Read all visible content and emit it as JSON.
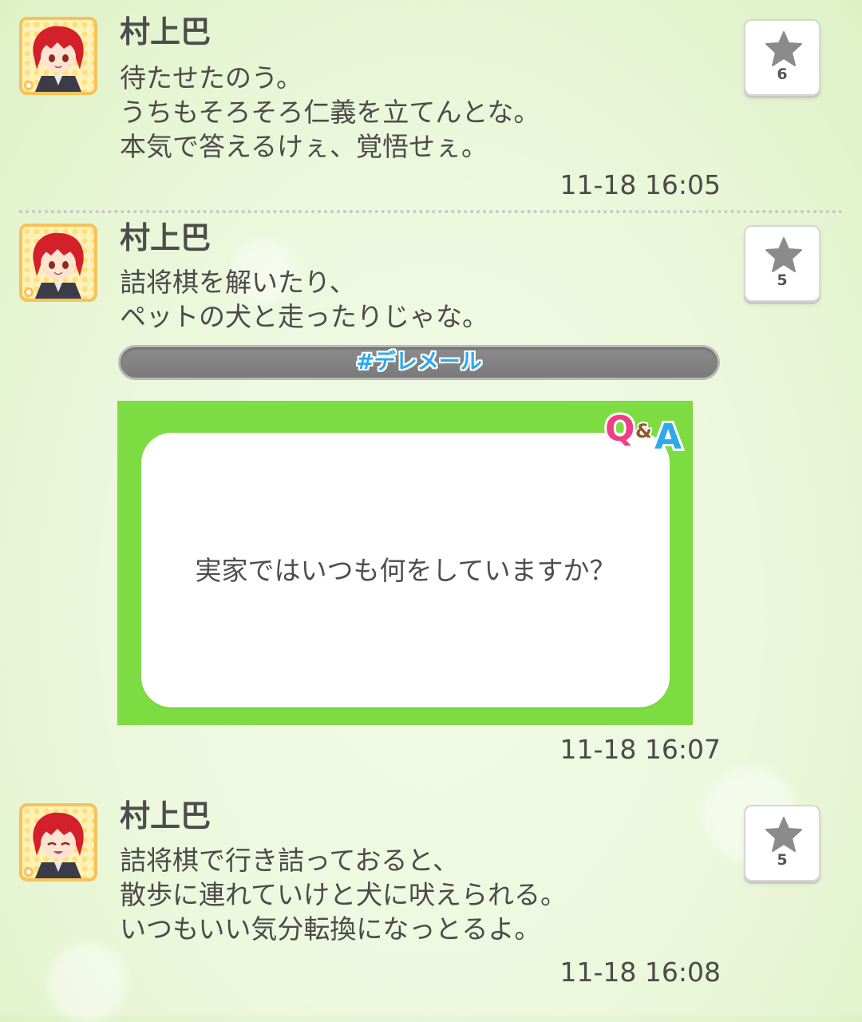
{
  "posts": [
    {
      "author": "村上巴",
      "lines": [
        "待たせたのう。",
        "うちもそろそろ仁義を立てんとな。",
        "本気で答えるけぇ、覚悟せぇ。"
      ],
      "likes": "6",
      "timestamp": "11-18 16:05"
    },
    {
      "author": "村上巴",
      "lines": [
        "詰将棋を解いたり、",
        "ペットの犬と走ったりじゃな。"
      ],
      "likes": "5",
      "hashtag": "#デレメール",
      "qa_logo": "Q&A",
      "question": "実家ではいつも何をしていますか？",
      "timestamp": "11-18 16:07"
    },
    {
      "author": "村上巴",
      "lines": [
        "詰将棋で行き詰っておると、",
        "散歩に連れていけと犬に吠えられる。",
        "いつもいい気分転換になっとるよ。"
      ],
      "likes": "5",
      "timestamp": "11-18 16:08"
    }
  ],
  "colors": {
    "accent_green": "#7ddc42",
    "hashtag_blue": "#2fa9ea",
    "avatar_border": "#f6c35b"
  },
  "icons": {
    "like": "star-icon",
    "avatar": "character-avatar"
  }
}
